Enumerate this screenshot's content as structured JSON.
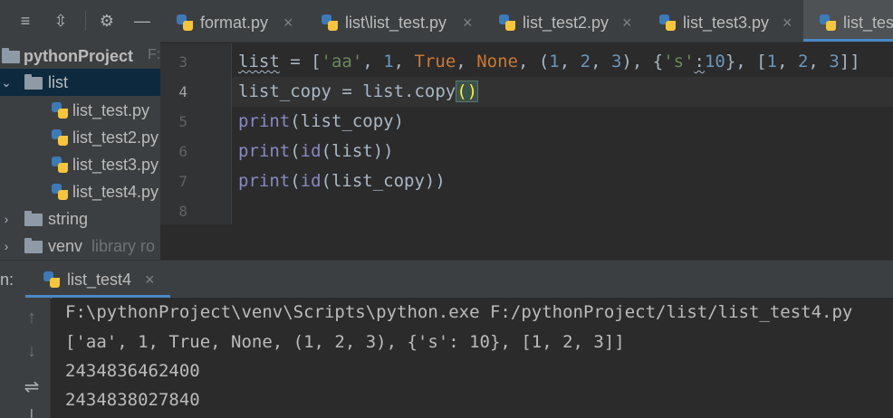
{
  "project": {
    "toolbar": [
      {
        "icon": "collapse-all-icon",
        "glyph": "≡"
      },
      {
        "icon": "expand-icon",
        "glyph": "⇳"
      },
      {
        "icon": "gear-icon",
        "glyph": "⚙"
      },
      {
        "icon": "minimize-icon",
        "glyph": "—"
      }
    ],
    "root": {
      "label": "pythonProject",
      "path_fragment": "F:"
    },
    "list_folder": "list",
    "files": [
      "list_test.py",
      "list_test2.py",
      "list_test3.py",
      "list_test4.py"
    ],
    "string_folder": "string",
    "venv_folder": "venv",
    "venv_hint": "library ro"
  },
  "tabs": [
    {
      "label": "format.py",
      "close": "×"
    },
    {
      "label": "list\\list_test.py",
      "close": "×"
    },
    {
      "label": "list_test2.py",
      "close": "×"
    },
    {
      "label": "list_test3.py",
      "close": "×"
    },
    {
      "label": "list_tes",
      "close": ""
    }
  ],
  "editor": {
    "line_numbers": [
      "3",
      "4",
      "5",
      "6",
      "7",
      "8"
    ],
    "current_line": "4"
  },
  "run": {
    "title": "n:",
    "tab_label": "list_test4",
    "tab_close": "×",
    "side_buttons": [
      {
        "icon": "arrow-up-icon",
        "glyph": "↑"
      },
      {
        "icon": "arrow-down-icon",
        "glyph": "↓"
      },
      {
        "icon": "soft-wrap-icon",
        "glyph": "⇌"
      },
      {
        "icon": "print-icon",
        "glyph": "⊥"
      }
    ],
    "console": [
      "F:\\pythonProject\\venv\\Scripts\\python.exe F:/pythonProject/list/list_test4.py",
      "['aa', 1, True, None, (1, 2, 3), {'s': 10}, [1, 2, 3]]",
      "2434836462400",
      "2434838027840"
    ]
  },
  "colors": {
    "accent": "#4a88c7",
    "selection": "#0d293e",
    "editor_bg": "#2b2b2b",
    "panel_bg": "#3c3f41",
    "keyword": "#cc7832",
    "number": "#6897bb",
    "string": "#6a8759",
    "builtin": "#8888c6"
  }
}
